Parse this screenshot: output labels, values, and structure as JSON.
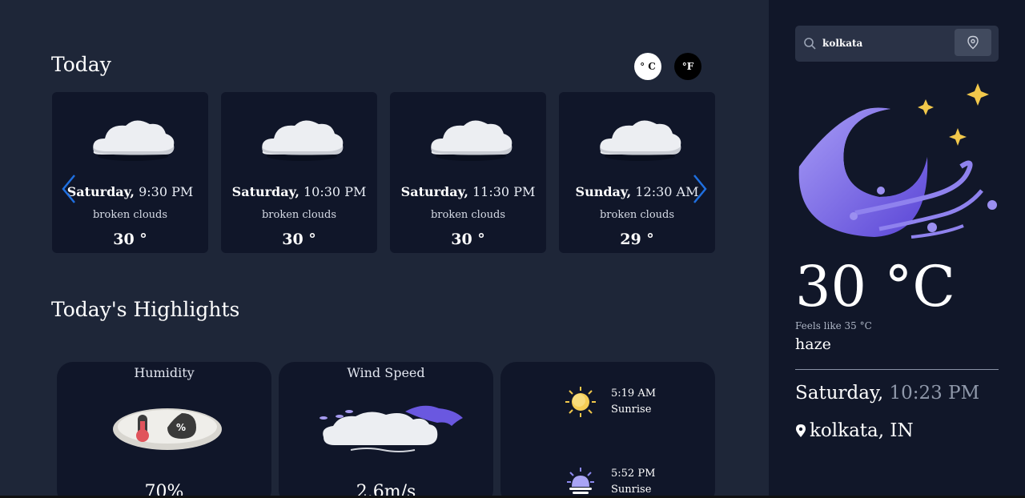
{
  "today": {
    "title": "Today",
    "unit_celsius": "° C",
    "unit_fahrenheit": "°F"
  },
  "forecast": [
    {
      "day": "Saturday,",
      "time": "9:30 PM",
      "desc": "broken clouds",
      "temp": "30 °"
    },
    {
      "day": "Saturday,",
      "time": "10:30 PM",
      "desc": "broken clouds",
      "temp": "30 °"
    },
    {
      "day": "Saturday,",
      "time": "11:30 PM",
      "desc": "broken clouds",
      "temp": "30 °"
    },
    {
      "day": "Sunday,",
      "time": "12:30 AM",
      "desc": "broken clouds",
      "temp": "29 °"
    }
  ],
  "highlights": {
    "title": "Today's Highlights",
    "humidity_label": "Humidity",
    "humidity_value": "70%",
    "wind_label": "Wind Speed",
    "wind_value": "2.6m/s",
    "sunrise_time": "5:19 AM",
    "sunrise_label": "Sunrise",
    "sunset_time": "5:52 PM",
    "sunset_label": "Sunrise"
  },
  "sidebar": {
    "search_value": "kolkata",
    "temperature": "30 °C",
    "feels_like": "Feels like 35 °C",
    "condition": "haze",
    "date_day": "Saturday,",
    "date_time": "10:23 PM",
    "location": "kolkata, IN"
  },
  "colors": {
    "background": "#1e2638",
    "card": "#101629",
    "sidebar": "#111729",
    "accent_arrow": "#1f6fe0",
    "moon": "#7c6bf2"
  }
}
